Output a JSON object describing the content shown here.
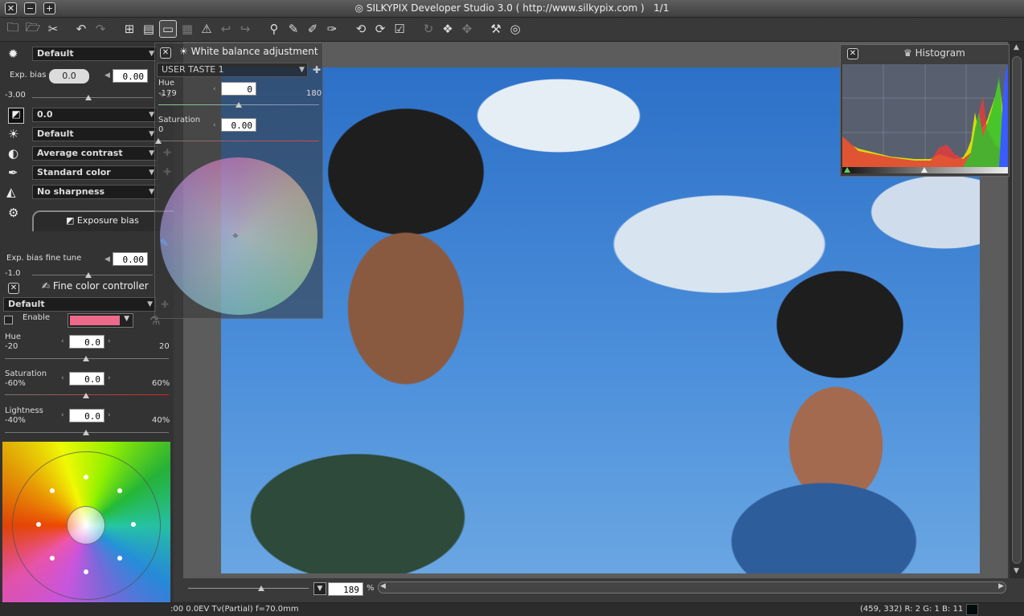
{
  "window": {
    "title": "SILKYPIX Developer Studio 3.0 ( http://www.silkypix.com )",
    "page_counter": "1/1",
    "close": "✕",
    "minimize": "−",
    "maximize": "+"
  },
  "toolbar": {
    "icons": [
      "open-folder-icon",
      "open-folders-icon",
      "batch-icon",
      "undo-icon",
      "redo-icon",
      "grid-view-icon",
      "combined-view-icon",
      "preview-view-icon",
      "full-preview-icon",
      "warning-icon",
      "previous-icon",
      "next-icon",
      "zoom-icon",
      "picker-icon",
      "picker2-icon",
      "gray-point-icon",
      "rotate-left-icon",
      "rotate-right-icon",
      "mark-icon",
      "refresh-icon",
      "develop-icon",
      "develop-all-icon",
      "tool-icon",
      "settings-icon"
    ]
  },
  "left": {
    "taste": {
      "value": "Default"
    },
    "exp_bias": {
      "label": "Exp. bias",
      "button": "0.0",
      "value": "0.00",
      "min": "-3.00",
      "max": "+3"
    },
    "exposure_value": "0.0",
    "wb_preset": "Default",
    "contrast": "Average contrast",
    "color": "Standard color",
    "sharpness": "No sharpness",
    "tab_label": "Exposure bias",
    "fine_tune": {
      "label": "Exp. bias fine tune",
      "value": "0.00",
      "min": "-1.0",
      "max": "+1.0"
    }
  },
  "wb": {
    "title": "White balance adjustment",
    "preset": "USER TASTE 1",
    "hue_label": "Hue",
    "hue_value": "0",
    "hue_min": "-179",
    "hue_max": "180",
    "sat_label": "Saturation",
    "sat_value": "0.00",
    "sat_min": "0"
  },
  "histogram": {
    "title": "Histogram"
  },
  "fcc": {
    "title": "Fine color controller",
    "preset": "Default",
    "enable": "Enable",
    "hue": {
      "label": "Hue",
      "value": "0.0",
      "min": "-20",
      "max": "20"
    },
    "saturation": {
      "label": "Saturation",
      "value": "0.0",
      "min": "-60%",
      "max": "60%"
    },
    "lightness": {
      "label": "Lightness",
      "value": "0.0",
      "min": "-40%",
      "max": "40%"
    },
    "color_swatch": "#ee6a8a"
  },
  "zoom": {
    "value": "189",
    "unit": "%"
  },
  "status": {
    "left": ":00  0.0EV Tv(Partial) f=70.0mm",
    "right": "(459, 332) R:  2 G:  1 B: 11"
  }
}
